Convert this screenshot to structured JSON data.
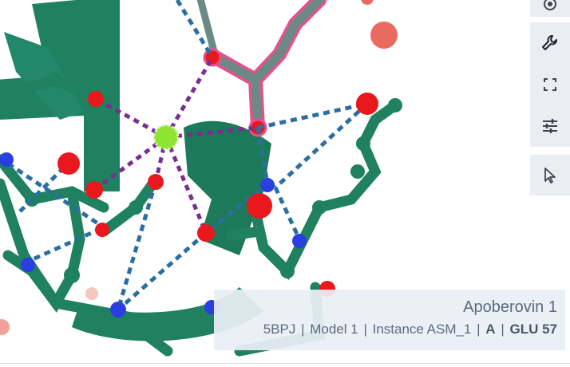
{
  "viewer": {
    "structure_label": "Apoberovin 1",
    "details": {
      "pdb_id": "5BPJ",
      "model": "Model 1",
      "instance": "Instance ASM_1",
      "chain": "A",
      "residue": "GLU 57"
    },
    "colors": {
      "protein": "#1f8160",
      "oxygen": "#e8181c",
      "nitrogen": "#2a3fe0",
      "metal_ion": "#8ee432",
      "ligand": "#6b8a86",
      "ligand_highlight": "#e6508f",
      "water": "#e96a5e",
      "metal_coordination": "#7a2e8f",
      "hydrogen_bond": "#2b6fa0"
    }
  },
  "toolbar": {
    "buttons": [
      {
        "name": "screenshot-button",
        "icon": "camera-icon"
      },
      {
        "name": "settings-button",
        "icon": "wrench-icon"
      },
      {
        "name": "fullscreen-button",
        "icon": "expand-icon"
      },
      {
        "name": "controls-button",
        "icon": "sliders-icon"
      },
      {
        "name": "selection-mode-button",
        "icon": "cursor-icon"
      }
    ]
  }
}
